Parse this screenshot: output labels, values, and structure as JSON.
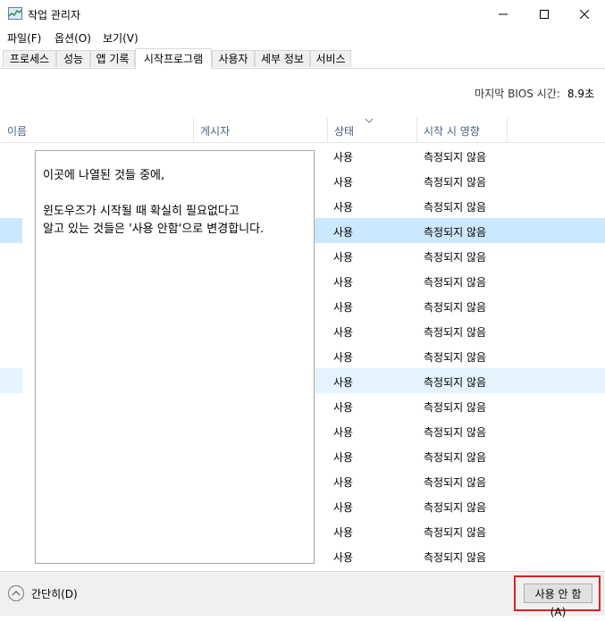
{
  "window": {
    "title": "작업 관리자"
  },
  "menu": [
    "파일(F)",
    "옵션(O)",
    "보기(V)"
  ],
  "tabs": [
    "프로세스",
    "성능",
    "앱 기록",
    "시작프로그램",
    "사용자",
    "세부 정보",
    "서비스"
  ],
  "active_tab": "시작프로그램",
  "bios": {
    "label": "마지막 BIOS 시간:",
    "value": "8.9초"
  },
  "columns": {
    "name": "이름",
    "publisher": "게시자",
    "status": "상태",
    "impact": "시작 시 영향"
  },
  "rows": [
    {
      "status": "사용",
      "impact": "측정되지 않음"
    },
    {
      "status": "사용",
      "impact": "측정되지 않음"
    },
    {
      "status": "사용",
      "impact": "측정되지 않음"
    },
    {
      "status": "사용",
      "impact": "측정되지 않음"
    },
    {
      "status": "사용",
      "impact": "측정되지 않음"
    },
    {
      "status": "사용",
      "impact": "측정되지 않음"
    },
    {
      "status": "사용",
      "impact": "측정되지 않음"
    },
    {
      "status": "사용",
      "impact": "측정되지 않음"
    },
    {
      "status": "사용",
      "impact": "측정되지 않음"
    },
    {
      "status": "사용",
      "impact": "측정되지 않음"
    },
    {
      "status": "사용",
      "impact": "측정되지 않음"
    },
    {
      "status": "사용",
      "impact": "측정되지 않음"
    },
    {
      "status": "사용",
      "impact": "측정되지 않음"
    },
    {
      "status": "사용",
      "impact": "측정되지 않음"
    },
    {
      "status": "사용",
      "impact": "측정되지 않음"
    },
    {
      "status": "사용",
      "impact": "측정되지 않음"
    },
    {
      "status": "사용",
      "impact": "측정되지 않음"
    }
  ],
  "selected_row_index": 3,
  "hover_row_index": 9,
  "note": {
    "line1": "이곳에 나열된 것들 중에,",
    "line2": "윈도우즈가 시작될 때 확실히 필요없다고",
    "line3": "알고 있는 것들은 '사용 안함'으로 변경합니다."
  },
  "footer": {
    "collapse_label": "간단히(D)",
    "disable_button": "사용 안 함(A)"
  },
  "colors": {
    "selection": "#cce8ff",
    "hover": "#e5f3ff",
    "highlight_border": "#e02020"
  }
}
